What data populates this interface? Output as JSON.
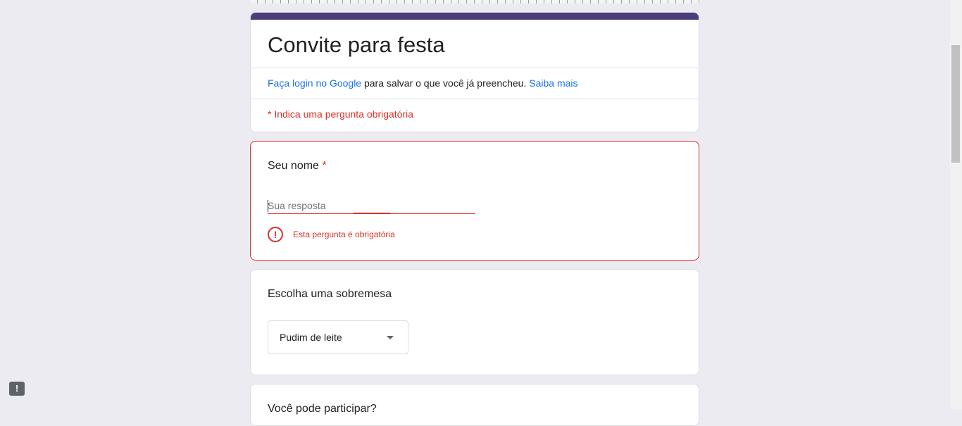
{
  "form": {
    "title": "Convite para festa",
    "login_link": "Faça login no Google",
    "login_text": " para salvar o que você já preencheu. ",
    "learn_more_link": "Saiba mais",
    "required_note": "* Indica uma pergunta obrigatória",
    "accent_color": "#4c3d7d",
    "error_color": "#d93025"
  },
  "questions": {
    "name": {
      "title": "Seu nome",
      "required_mark": "*",
      "placeholder": "Sua resposta",
      "error": "Esta pergunta é obrigatória"
    },
    "dessert": {
      "title": "Escolha uma sobremesa",
      "selected": "Pudim de leite"
    },
    "attend": {
      "title": "Você pode participar?"
    }
  },
  "icons": {
    "error": "exclamation-circle-icon",
    "feedback": "feedback-icon"
  }
}
